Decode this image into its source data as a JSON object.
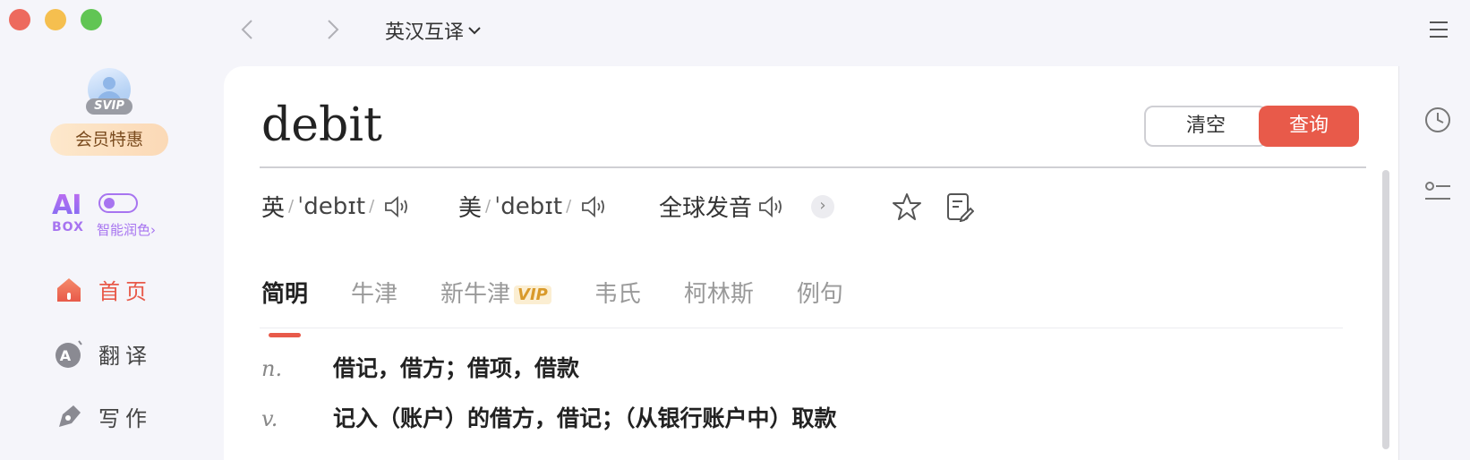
{
  "window": {
    "mode_label": "英汉互译"
  },
  "sidebar": {
    "badge": "SVIP",
    "member_label": "会员特惠",
    "ai_box": {
      "logo": "AI",
      "box_label": "BOX",
      "polish_label": "智能润色"
    },
    "items": [
      {
        "label": "首页",
        "icon": "home-icon",
        "active": true
      },
      {
        "label": "翻译",
        "icon": "translate-icon",
        "active": false
      },
      {
        "label": "写作",
        "icon": "pen-icon",
        "active": false
      }
    ]
  },
  "search": {
    "query": "debit",
    "clear_label": "清空",
    "search_label": "查询"
  },
  "pronunciation": {
    "uk_label": "英",
    "uk_ipa": "ˈdebɪt",
    "us_label": "美",
    "us_ipa": "ˈdebɪt",
    "global_label": "全球发音"
  },
  "tabs": [
    {
      "label": "简明",
      "active": true
    },
    {
      "label": "牛津"
    },
    {
      "label": "新牛津",
      "badge": "VIP"
    },
    {
      "label": "韦氏"
    },
    {
      "label": "柯林斯"
    },
    {
      "label": "例句"
    }
  ],
  "definitions": [
    {
      "pos": "n.",
      "meaning": "借记，借方；借项，借款"
    },
    {
      "pos": "v.",
      "meaning": "记入（账户）的借方，借记；（从银行账户中）取款"
    }
  ],
  "colors": {
    "accent": "#e85a4a",
    "ai_purple": "#a774f0",
    "vip_gold": "#d99a2b"
  }
}
